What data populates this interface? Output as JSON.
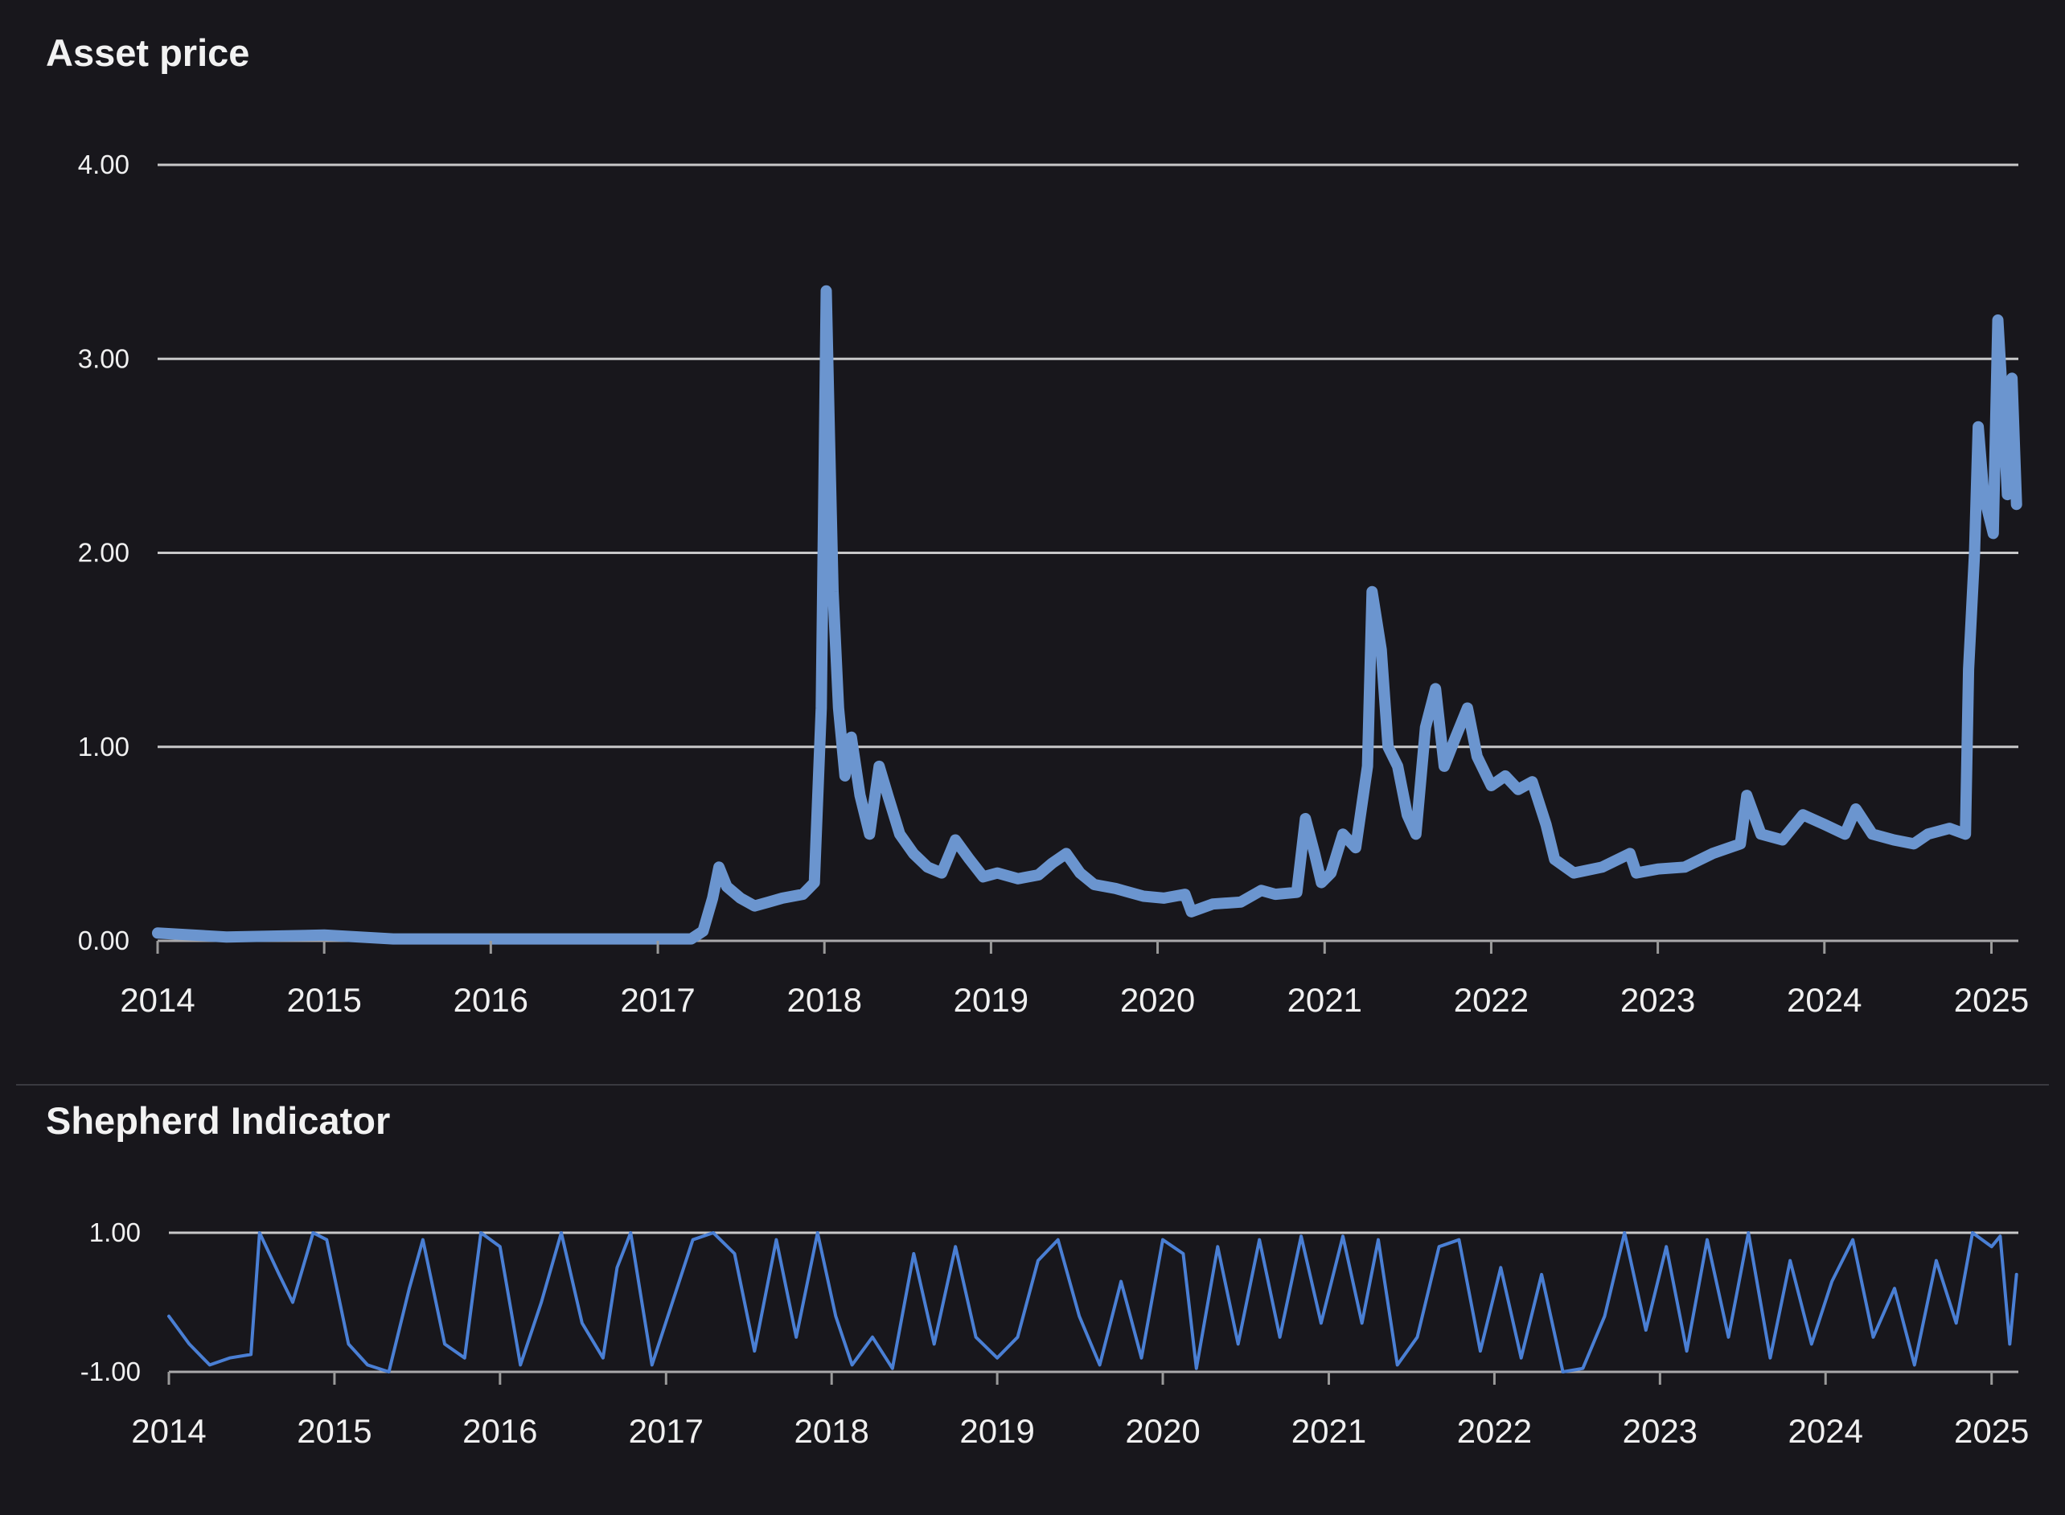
{
  "chart_data": [
    {
      "type": "line",
      "title": "Asset price",
      "xlabel": "",
      "ylabel": "",
      "x_ticks": [
        "2014",
        "2015",
        "2016",
        "2017",
        "2018",
        "2019",
        "2020",
        "2021",
        "2022",
        "2023",
        "2024",
        "2025"
      ],
      "y_ticks": [
        "0.00",
        "1.00",
        "2.00",
        "3.00",
        "4.00"
      ],
      "xlim": [
        "2014-01-01",
        "2025-03-01"
      ],
      "ylim": [
        0,
        4
      ],
      "grid": true,
      "colors": {
        "series": "#6b95cf",
        "grid": "#e8e8e8",
        "background": "#18171c",
        "text": "#f0f0f0"
      },
      "series": [
        {
          "points": [
            [
              "2014-01-01",
              0.04
            ],
            [
              "2014-06-01",
              0.02
            ],
            [
              "2015-01-01",
              0.03
            ],
            [
              "2015-06-01",
              0.01
            ],
            [
              "2016-01-01",
              0.01
            ],
            [
              "2016-06-01",
              0.01
            ],
            [
              "2017-01-01",
              0.01
            ],
            [
              "2017-03-15",
              0.01
            ],
            [
              "2017-04-10",
              0.05
            ],
            [
              "2017-05-01",
              0.22
            ],
            [
              "2017-05-15",
              0.38
            ],
            [
              "2017-06-01",
              0.28
            ],
            [
              "2017-07-01",
              0.22
            ],
            [
              "2017-08-01",
              0.18
            ],
            [
              "2017-09-01",
              0.2
            ],
            [
              "2017-10-01",
              0.22
            ],
            [
              "2017-11-15",
              0.24
            ],
            [
              "2017-12-10",
              0.3
            ],
            [
              "2017-12-25",
              1.2
            ],
            [
              "2018-01-05",
              3.35
            ],
            [
              "2018-01-12",
              2.6
            ],
            [
              "2018-01-20",
              1.8
            ],
            [
              "2018-02-01",
              1.2
            ],
            [
              "2018-02-15",
              0.85
            ],
            [
              "2018-03-01",
              1.05
            ],
            [
              "2018-03-20",
              0.75
            ],
            [
              "2018-04-10",
              0.55
            ],
            [
              "2018-05-01",
              0.9
            ],
            [
              "2018-05-20",
              0.75
            ],
            [
              "2018-06-15",
              0.55
            ],
            [
              "2018-07-15",
              0.45
            ],
            [
              "2018-08-15",
              0.38
            ],
            [
              "2018-09-15",
              0.35
            ],
            [
              "2018-10-15",
              0.52
            ],
            [
              "2018-11-15",
              0.42
            ],
            [
              "2018-12-15",
              0.33
            ],
            [
              "2019-01-15",
              0.35
            ],
            [
              "2019-03-01",
              0.32
            ],
            [
              "2019-04-15",
              0.34
            ],
            [
              "2019-05-15",
              0.4
            ],
            [
              "2019-06-15",
              0.45
            ],
            [
              "2019-07-15",
              0.35
            ],
            [
              "2019-08-15",
              0.29
            ],
            [
              "2019-10-01",
              0.27
            ],
            [
              "2019-12-01",
              0.23
            ],
            [
              "2020-01-15",
              0.22
            ],
            [
              "2020-03-01",
              0.24
            ],
            [
              "2020-03-15",
              0.15
            ],
            [
              "2020-05-01",
              0.19
            ],
            [
              "2020-07-01",
              0.2
            ],
            [
              "2020-08-15",
              0.26
            ],
            [
              "2020-09-15",
              0.24
            ],
            [
              "2020-11-01",
              0.25
            ],
            [
              "2020-11-20",
              0.63
            ],
            [
              "2020-12-10",
              0.45
            ],
            [
              "2020-12-25",
              0.3
            ],
            [
              "2021-01-15",
              0.35
            ],
            [
              "2021-02-10",
              0.55
            ],
            [
              "2021-03-10",
              0.48
            ],
            [
              "2021-04-05",
              0.9
            ],
            [
              "2021-04-15",
              1.8
            ],
            [
              "2021-05-05",
              1.5
            ],
            [
              "2021-05-20",
              1.0
            ],
            [
              "2021-06-10",
              0.9
            ],
            [
              "2021-07-01",
              0.65
            ],
            [
              "2021-07-20",
              0.55
            ],
            [
              "2021-08-10",
              1.1
            ],
            [
              "2021-09-01",
              1.3
            ],
            [
              "2021-09-20",
              0.9
            ],
            [
              "2021-10-15",
              1.05
            ],
            [
              "2021-11-10",
              1.2
            ],
            [
              "2021-12-01",
              0.95
            ],
            [
              "2022-01-01",
              0.8
            ],
            [
              "2022-02-01",
              0.85
            ],
            [
              "2022-03-01",
              0.78
            ],
            [
              "2022-04-01",
              0.82
            ],
            [
              "2022-05-01",
              0.6
            ],
            [
              "2022-05-20",
              0.42
            ],
            [
              "2022-07-01",
              0.35
            ],
            [
              "2022-09-01",
              0.38
            ],
            [
              "2022-11-01",
              0.45
            ],
            [
              "2022-11-15",
              0.35
            ],
            [
              "2023-01-01",
              0.37
            ],
            [
              "2023-03-01",
              0.38
            ],
            [
              "2023-05-01",
              0.45
            ],
            [
              "2023-07-01",
              0.5
            ],
            [
              "2023-07-15",
              0.75
            ],
            [
              "2023-08-15",
              0.55
            ],
            [
              "2023-10-01",
              0.52
            ],
            [
              "2023-11-15",
              0.65
            ],
            [
              "2024-01-01",
              0.6
            ],
            [
              "2024-02-15",
              0.55
            ],
            [
              "2024-03-10",
              0.68
            ],
            [
              "2024-04-15",
              0.55
            ],
            [
              "2024-06-01",
              0.52
            ],
            [
              "2024-07-15",
              0.5
            ],
            [
              "2024-08-15",
              0.55
            ],
            [
              "2024-10-01",
              0.58
            ],
            [
              "2024-11-05",
              0.55
            ],
            [
              "2024-11-12",
              1.4
            ],
            [
              "2024-11-25",
              2.0
            ],
            [
              "2024-12-03",
              2.65
            ],
            [
              "2024-12-15",
              2.3
            ],
            [
              "2025-01-05",
              2.1
            ],
            [
              "2025-01-15",
              3.2
            ],
            [
              "2025-01-25",
              2.8
            ],
            [
              "2025-02-05",
              2.3
            ],
            [
              "2025-02-15",
              2.9
            ],
            [
              "2025-02-25",
              2.25
            ]
          ]
        }
      ]
    },
    {
      "type": "line",
      "title": "Shepherd Indicator",
      "xlabel": "",
      "ylabel": "",
      "x_ticks": [
        "2014",
        "2015",
        "2016",
        "2017",
        "2018",
        "2019",
        "2020",
        "2021",
        "2022",
        "2023",
        "2024",
        "2025"
      ],
      "y_ticks": [
        "-1.00",
        "1.00"
      ],
      "xlim": [
        "2014-01-01",
        "2025-03-01"
      ],
      "ylim": [
        -1,
        1
      ],
      "grid": true,
      "colors": {
        "series": "#4a7fd4",
        "grid": "#e8e8e8",
        "background": "#18171c",
        "text": "#f0f0f0"
      },
      "series": [
        {
          "points": [
            [
              "2014-01-01",
              -0.2
            ],
            [
              "2014-02-15",
              -0.6
            ],
            [
              "2014-04-01",
              -0.9
            ],
            [
              "2014-05-15",
              -0.8
            ],
            [
              "2014-07-01",
              -0.75
            ],
            [
              "2014-07-20",
              1.0
            ],
            [
              "2014-09-01",
              0.4
            ],
            [
              "2014-10-01",
              0.0
            ],
            [
              "2014-11-15",
              1.0
            ],
            [
              "2014-12-15",
              0.9
            ],
            [
              "2015-02-01",
              -0.6
            ],
            [
              "2015-03-15",
              -0.9
            ],
            [
              "2015-05-01",
              -1.0
            ],
            [
              "2015-06-15",
              0.2
            ],
            [
              "2015-07-15",
              0.9
            ],
            [
              "2015-09-01",
              -0.6
            ],
            [
              "2015-10-15",
              -0.8
            ],
            [
              "2015-11-20",
              1.0
            ],
            [
              "2016-01-01",
              0.8
            ],
            [
              "2016-02-15",
              -0.9
            ],
            [
              "2016-04-01",
              0.0
            ],
            [
              "2016-05-15",
              1.0
            ],
            [
              "2016-06-30",
              -0.3
            ],
            [
              "2016-08-15",
              -0.8
            ],
            [
              "2016-09-15",
              0.5
            ],
            [
              "2016-10-15",
              1.0
            ],
            [
              "2016-12-01",
              -0.9
            ],
            [
              "2017-01-15",
              0.0
            ],
            [
              "2017-03-01",
              0.9
            ],
            [
              "2017-04-15",
              1.0
            ],
            [
              "2017-06-01",
              0.7
            ],
            [
              "2017-07-15",
              -0.7
            ],
            [
              "2017-09-01",
              0.9
            ],
            [
              "2017-10-15",
              -0.5
            ],
            [
              "2017-12-01",
              1.0
            ],
            [
              "2018-01-10",
              -0.2
            ],
            [
              "2018-02-15",
              -0.9
            ],
            [
              "2018-04-01",
              -0.5
            ],
            [
              "2018-05-15",
              -0.95
            ],
            [
              "2018-07-01",
              0.7
            ],
            [
              "2018-08-15",
              -0.6
            ],
            [
              "2018-10-01",
              0.8
            ],
            [
              "2018-11-15",
              -0.5
            ],
            [
              "2019-01-01",
              -0.8
            ],
            [
              "2019-02-15",
              -0.5
            ],
            [
              "2019-04-01",
              0.6
            ],
            [
              "2019-05-15",
              0.9
            ],
            [
              "2019-07-01",
              -0.2
            ],
            [
              "2019-08-15",
              -0.9
            ],
            [
              "2019-10-01",
              0.3
            ],
            [
              "2019-11-15",
              -0.8
            ],
            [
              "2020-01-01",
              0.9
            ],
            [
              "2020-02-15",
              0.7
            ],
            [
              "2020-03-15",
              -0.95
            ],
            [
              "2020-05-01",
              0.8
            ],
            [
              "2020-06-15",
              -0.6
            ],
            [
              "2020-08-01",
              0.9
            ],
            [
              "2020-09-15",
              -0.5
            ],
            [
              "2020-11-01",
              0.95
            ],
            [
              "2020-12-15",
              -0.3
            ],
            [
              "2021-02-01",
              0.95
            ],
            [
              "2021-03-15",
              -0.3
            ],
            [
              "2021-04-20",
              0.9
            ],
            [
              "2021-06-01",
              -0.9
            ],
            [
              "2021-07-15",
              -0.5
            ],
            [
              "2021-09-01",
              0.8
            ],
            [
              "2021-10-15",
              0.9
            ],
            [
              "2021-12-01",
              -0.7
            ],
            [
              "2022-01-15",
              0.5
            ],
            [
              "2022-03-01",
              -0.8
            ],
            [
              "2022-04-15",
              0.4
            ],
            [
              "2022-06-01",
              -1.0
            ],
            [
              "2022-07-15",
              -0.95
            ],
            [
              "2022-09-01",
              -0.2
            ],
            [
              "2022-10-15",
              1.0
            ],
            [
              "2022-12-01",
              -0.4
            ],
            [
              "2023-01-15",
              0.8
            ],
            [
              "2023-03-01",
              -0.7
            ],
            [
              "2023-04-15",
              0.9
            ],
            [
              "2023-06-01",
              -0.5
            ],
            [
              "2023-07-15",
              1.0
            ],
            [
              "2023-09-01",
              -0.8
            ],
            [
              "2023-10-15",
              0.6
            ],
            [
              "2023-12-01",
              -0.6
            ],
            [
              "2024-01-15",
              0.3
            ],
            [
              "2024-03-01",
              0.9
            ],
            [
              "2024-04-15",
              -0.5
            ],
            [
              "2024-06-01",
              0.2
            ],
            [
              "2024-07-15",
              -0.9
            ],
            [
              "2024-09-01",
              0.6
            ],
            [
              "2024-10-15",
              -0.3
            ],
            [
              "2024-11-20",
              1.0
            ],
            [
              "2025-01-01",
              0.8
            ],
            [
              "2025-01-20",
              0.95
            ],
            [
              "2025-02-10",
              -0.6
            ],
            [
              "2025-02-25",
              0.4
            ]
          ]
        }
      ]
    }
  ]
}
